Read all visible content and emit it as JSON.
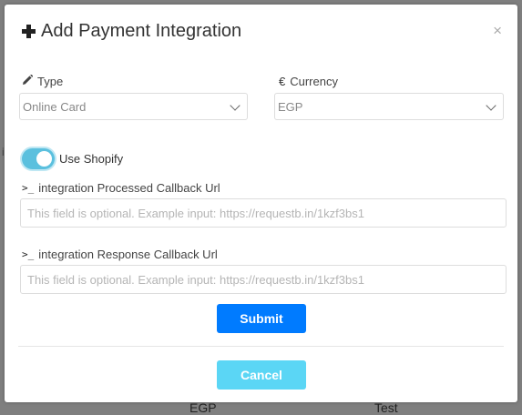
{
  "backdrop": {
    "left_cell": "EGP",
    "right_cell": "Test",
    "left_marker": "i"
  },
  "modal": {
    "title": "Add Payment Integration",
    "close_glyph": "×",
    "title_icon": "plus-icon",
    "close_icon": "close-icon"
  },
  "type_field": {
    "label": "Type",
    "icon": "pencil-icon",
    "selected": "Online Card"
  },
  "currency_field": {
    "label": "Currency",
    "icon_glyph": "€",
    "selected": "EGP"
  },
  "shopify_toggle": {
    "label": "Use Shopify",
    "enabled": true,
    "color": "#5bc0de"
  },
  "processed_callback": {
    "label": "integration Processed Callback Url",
    "prompt_glyph": ">_",
    "placeholder": "This field is optional. Example input: https://requestb.in/1kzf3bs1"
  },
  "response_callback": {
    "label": "integration Response Callback Url",
    "prompt_glyph": ">_",
    "placeholder": "This field is optional. Example input: https://requestb.in/1kzf3bs1"
  },
  "actions": {
    "submit_label": "Submit",
    "cancel_label": "Cancel",
    "submit_color": "#007bff",
    "cancel_color": "#5bd6f5"
  }
}
